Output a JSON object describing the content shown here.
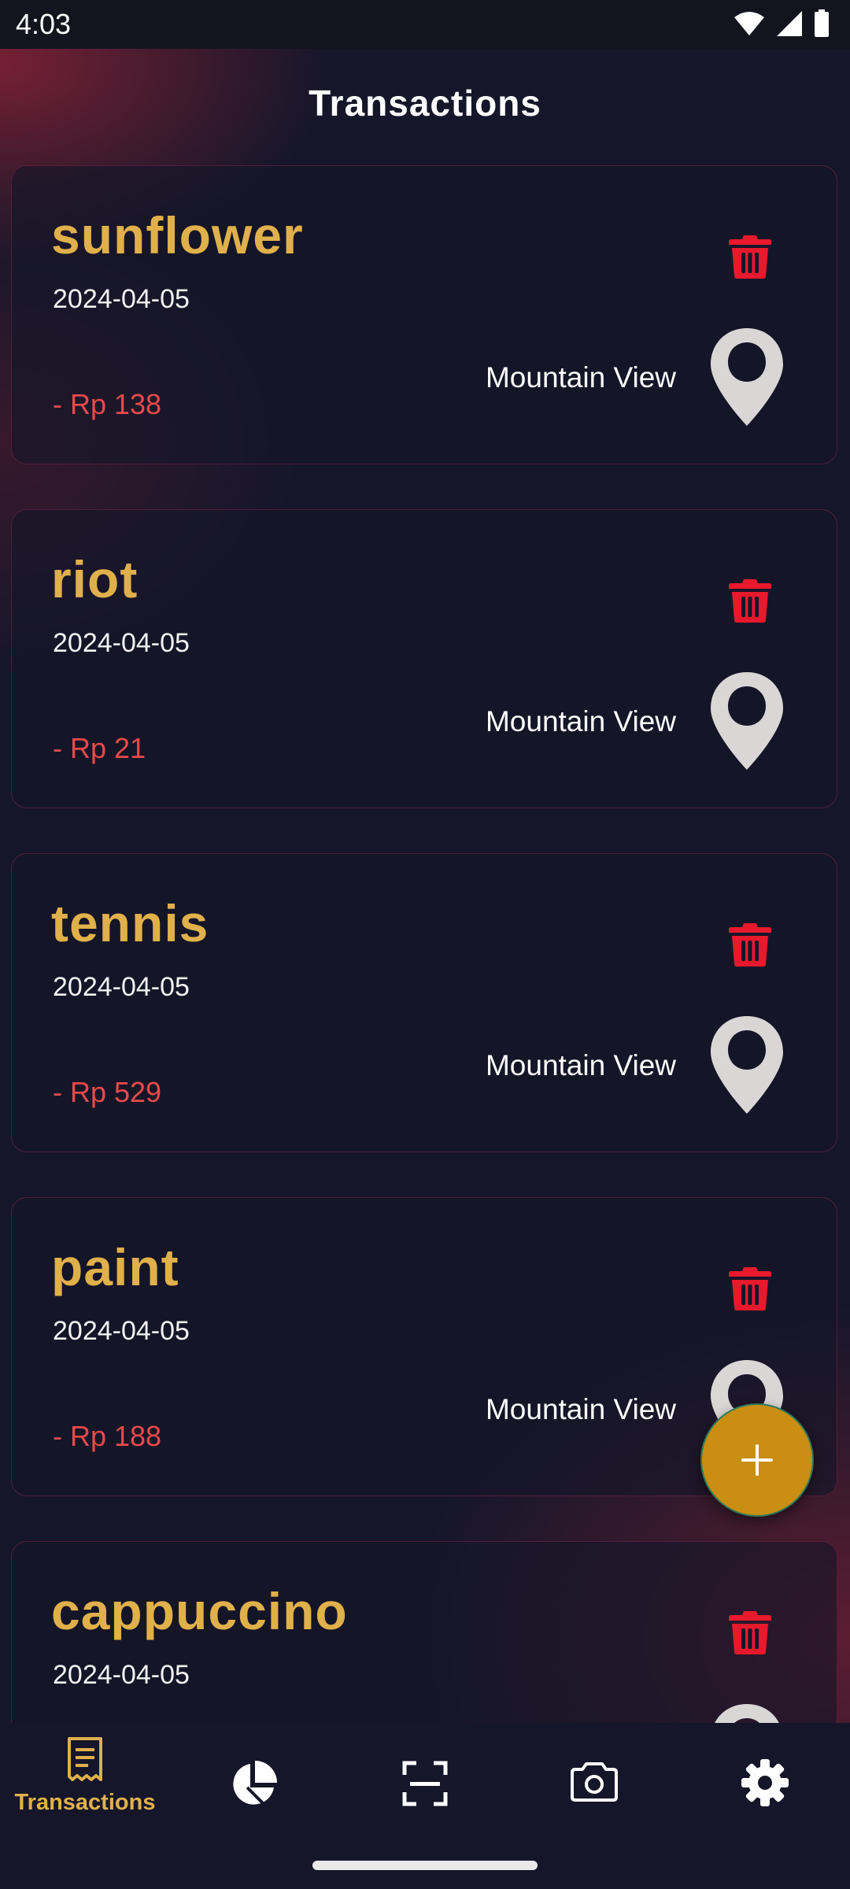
{
  "status_bar": {
    "time": "4:03",
    "icons": [
      "wifi-icon",
      "signal-icon",
      "battery-icon"
    ]
  },
  "header": {
    "title": "Transactions"
  },
  "transactions": [
    {
      "name": "sunflower",
      "date": "2024-04-05",
      "amount": "- Rp 138",
      "location": "Mountain View"
    },
    {
      "name": "riot",
      "date": "2024-04-05",
      "amount": "- Rp 21",
      "location": "Mountain View"
    },
    {
      "name": "tennis",
      "date": "2024-04-05",
      "amount": "- Rp 529",
      "location": "Mountain View"
    },
    {
      "name": "paint",
      "date": "2024-04-05",
      "amount": "- Rp 188",
      "location": "Mountain View"
    },
    {
      "name": "cappuccino",
      "date": "2024-04-05",
      "amount": "",
      "location": ""
    }
  ],
  "fab": {
    "icon": "plus-icon"
  },
  "bottom_nav": {
    "items": [
      {
        "label": "Transactions",
        "icon": "receipt-icon",
        "active": true
      },
      {
        "label": "",
        "icon": "pie-chart-icon",
        "active": false
      },
      {
        "label": "",
        "icon": "scan-icon",
        "active": false
      },
      {
        "label": "",
        "icon": "camera-icon",
        "active": false
      },
      {
        "label": "",
        "icon": "gear-icon",
        "active": false
      }
    ]
  },
  "colors": {
    "background": "#16162a",
    "accent": "#e0b04a",
    "amount": "#e84a4a",
    "delete": "#e8192c",
    "fab": "#c98e12",
    "pin": "#d9d6d6"
  }
}
